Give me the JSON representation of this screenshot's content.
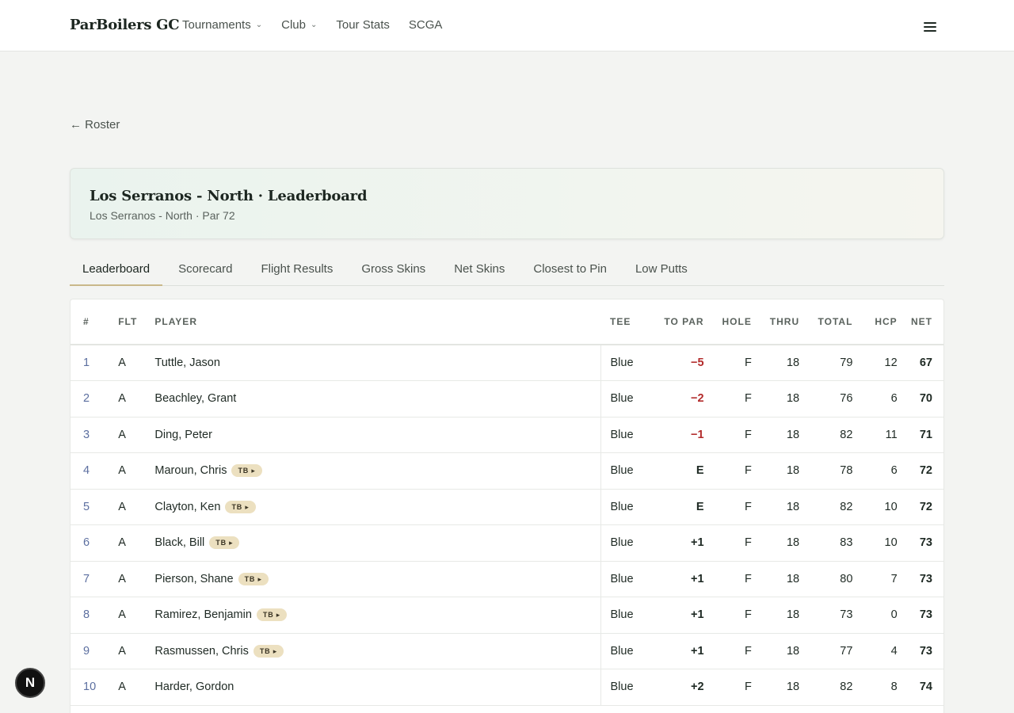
{
  "nav": {
    "brand": "ParBoilers GC",
    "links": [
      {
        "label": "Tournaments",
        "dropdown": true
      },
      {
        "label": "Club",
        "dropdown": true
      },
      {
        "label": "Tour Stats",
        "dropdown": false
      },
      {
        "label": "SCGA",
        "dropdown": false
      }
    ]
  },
  "back_label": "← Roster",
  "event": {
    "title": "Los Serranos - North · Leaderboard",
    "subtitle": "Los Serranos - North · Par 72"
  },
  "tabs": [
    "Leaderboard",
    "Scorecard",
    "Flight Results",
    "Gross Skins",
    "Net Skins",
    "Closest to Pin",
    "Low Putts"
  ],
  "active_tab": "Leaderboard",
  "table": {
    "headers": {
      "rank": "#",
      "flt": "FLT",
      "player": "PLAYER",
      "tee": "TEE",
      "topar": "TO PAR",
      "hole": "HOLE",
      "thru": "THRU",
      "total": "TOTAL",
      "hcp": "HCP",
      "net": "NET"
    },
    "tb_label": "TB ▸",
    "rows": [
      {
        "rank": "1",
        "flt": "A",
        "player": "Tuttle, Jason",
        "tb": false,
        "tee": "Blue",
        "topar": "−5",
        "hole": "F",
        "thru": "18",
        "total": "79",
        "hcp": "12",
        "net": "67"
      },
      {
        "rank": "2",
        "flt": "A",
        "player": "Beachley, Grant",
        "tb": false,
        "tee": "Blue",
        "topar": "−2",
        "hole": "F",
        "thru": "18",
        "total": "76",
        "hcp": "6",
        "net": "70"
      },
      {
        "rank": "3",
        "flt": "A",
        "player": "Ding, Peter",
        "tb": false,
        "tee": "Blue",
        "topar": "−1",
        "hole": "F",
        "thru": "18",
        "total": "82",
        "hcp": "11",
        "net": "71"
      },
      {
        "rank": "4",
        "flt": "A",
        "player": "Maroun, Chris",
        "tb": true,
        "tee": "Blue",
        "topar": "E",
        "hole": "F",
        "thru": "18",
        "total": "78",
        "hcp": "6",
        "net": "72"
      },
      {
        "rank": "5",
        "flt": "A",
        "player": "Clayton, Ken",
        "tb": true,
        "tee": "Blue",
        "topar": "E",
        "hole": "F",
        "thru": "18",
        "total": "82",
        "hcp": "10",
        "net": "72"
      },
      {
        "rank": "6",
        "flt": "A",
        "player": "Black, Bill",
        "tb": true,
        "tee": "Blue",
        "topar": "+1",
        "hole": "F",
        "thru": "18",
        "total": "83",
        "hcp": "10",
        "net": "73"
      },
      {
        "rank": "7",
        "flt": "A",
        "player": "Pierson, Shane",
        "tb": true,
        "tee": "Blue",
        "topar": "+1",
        "hole": "F",
        "thru": "18",
        "total": "80",
        "hcp": "7",
        "net": "73"
      },
      {
        "rank": "8",
        "flt": "A",
        "player": "Ramirez, Benjamin",
        "tb": true,
        "tee": "Blue",
        "topar": "+1",
        "hole": "F",
        "thru": "18",
        "total": "73",
        "hcp": "0",
        "net": "73"
      },
      {
        "rank": "9",
        "flt": "A",
        "player": "Rasmussen, Chris",
        "tb": true,
        "tee": "Blue",
        "topar": "+1",
        "hole": "F",
        "thru": "18",
        "total": "77",
        "hcp": "4",
        "net": "73"
      },
      {
        "rank": "10",
        "flt": "A",
        "player": "Harder, Gordon",
        "tb": false,
        "tee": "Blue",
        "topar": "+2",
        "hole": "F",
        "thru": "18",
        "total": "82",
        "hcp": "8",
        "net": "74"
      }
    ]
  },
  "fab_label": "N",
  "colors": {
    "accent_tab": "#c9b88a",
    "under_par": "#b32c2c",
    "rank_link": "#5c6fa0"
  }
}
